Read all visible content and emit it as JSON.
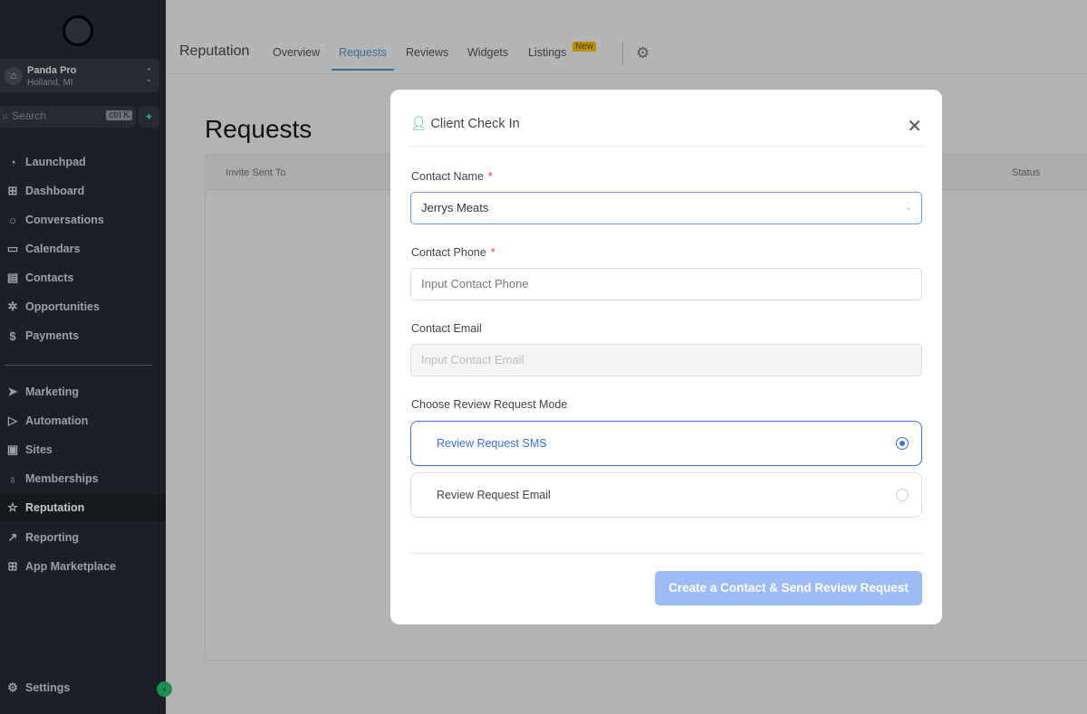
{
  "sidebar": {
    "location": {
      "name": "Panda Pro",
      "city": "Holland, MI"
    },
    "search": {
      "placeholder": "Search",
      "shortcut": "ctrl K"
    },
    "items": [
      {
        "label": "Launchpad",
        "icon": "rocket-icon"
      },
      {
        "label": "Dashboard",
        "icon": "grid-icon"
      },
      {
        "label": "Conversations",
        "icon": "chat-icon"
      },
      {
        "label": "Calendars",
        "icon": "calendar-icon"
      },
      {
        "label": "Contacts",
        "icon": "contacts-icon"
      },
      {
        "label": "Opportunities",
        "icon": "funnel-icon"
      },
      {
        "label": "Payments",
        "icon": "dollar-icon"
      },
      {
        "label": "Marketing",
        "icon": "send-icon"
      },
      {
        "label": "Automation",
        "icon": "play-icon"
      },
      {
        "label": "Sites",
        "icon": "sites-icon"
      },
      {
        "label": "Memberships",
        "icon": "award-icon"
      },
      {
        "label": "Reputation",
        "icon": "star-icon"
      },
      {
        "label": "Reporting",
        "icon": "trend-icon"
      },
      {
        "label": "App Marketplace",
        "icon": "apps-icon"
      }
    ],
    "settings": "Settings"
  },
  "header": {
    "title": "Reputation",
    "tabs": [
      "Overview",
      "Requests",
      "Reviews",
      "Widgets",
      "Listings"
    ],
    "active_tab": "Requests",
    "new_badge": "New"
  },
  "page": {
    "title": "Requests",
    "columns": [
      "Invite Sent To",
      "Status"
    ]
  },
  "modal": {
    "title": "Client Check In",
    "contact_name_label": "Contact Name",
    "contact_name_value": "Jerrys Meats",
    "contact_phone_label": "Contact Phone",
    "contact_phone_placeholder": "Input Contact Phone",
    "contact_email_label": "Contact Email",
    "contact_email_placeholder": "Input Contact Email",
    "mode_label": "Choose Review Request Mode",
    "modes": [
      "Review Request SMS",
      "Review Request Email"
    ],
    "selected_mode": "Review Request SMS",
    "required_mark": "*",
    "submit": "Create a Contact & Send Review Request"
  }
}
